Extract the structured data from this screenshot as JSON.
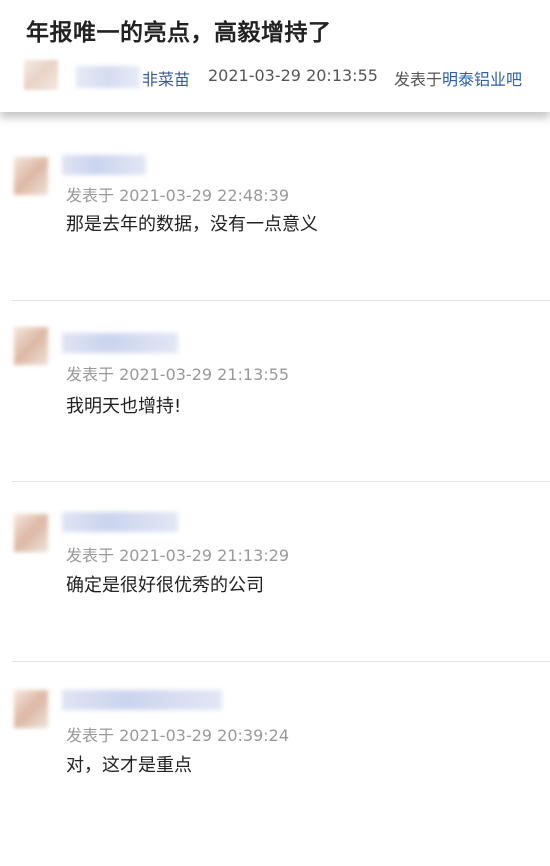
{
  "post": {
    "title": "年报唯一的亮点，高毅增持了",
    "author_suffix": "非菜苗",
    "time": "2021-03-29 20:13:55",
    "posted_in_label": "发表于",
    "forum": "明泰铝业吧"
  },
  "comments": [
    {
      "time_label": "发表于 2021-03-29 22:48:39",
      "text": "那是去年的数据，没有一点意义"
    },
    {
      "time_label": "发表于 2021-03-29 21:13:55",
      "text": "我明天也增持!"
    },
    {
      "time_label": "发表于 2021-03-29 21:13:29",
      "text": "确定是很好很优秀的公司"
    },
    {
      "time_label": "发表于 2021-03-29 20:39:24",
      "text": "对，这才是重点"
    }
  ]
}
